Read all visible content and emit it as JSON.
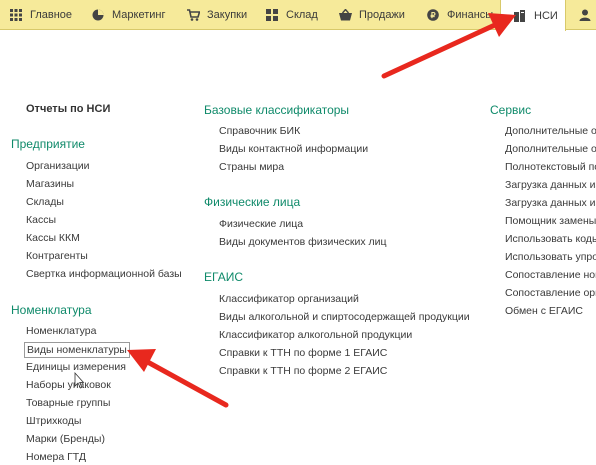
{
  "menu": [
    {
      "label": "Главное",
      "icon": "grid-icon"
    },
    {
      "label": "Маркетинг",
      "icon": "pie-chart-icon"
    },
    {
      "label": "Закупки",
      "icon": "cart-icon"
    },
    {
      "label": "Склад",
      "icon": "warehouse-icon"
    },
    {
      "label": "Продажи",
      "icon": "basket-icon"
    },
    {
      "label": "Финансы",
      "icon": "coin-icon"
    },
    {
      "label": "НСИ",
      "icon": "books-icon"
    },
    {
      "label": "",
      "icon": "user-icon"
    }
  ],
  "col1": {
    "reports": "Отчеты по НСИ",
    "enterprise": {
      "title": "Предприятие",
      "items": [
        "Организации",
        "Магазины",
        "Склады",
        "Кассы",
        "Кассы ККМ",
        "Контрагенты",
        "Свертка информационной базы"
      ]
    },
    "nomenclature": {
      "title": "Номенклатура",
      "items": [
        "Номенклатура",
        "Виды номенклатуры",
        "Единицы измерения",
        "Наборы упаковок",
        "Товарные группы",
        "Штрихкоды",
        "Марки (Бренды)",
        "Номера ГТД"
      ]
    }
  },
  "col2": {
    "base": {
      "title": "Базовые классификаторы",
      "items": [
        "Справочник БИК",
        "Виды контактной информации",
        "Страны мира"
      ]
    },
    "persons": {
      "title": "Физические лица",
      "items": [
        "Физические лица",
        "Виды документов физических лиц"
      ]
    },
    "egais": {
      "title": "ЕГАИС",
      "items": [
        "Классификатор организаций",
        "Виды алкогольной и спиртосодержащей продукции",
        "Классификатор алкогольной продукции",
        "Справки к ТТН по форме 1 ЕГАИС",
        "Справки к ТТН по форме 2 ЕГАИС"
      ]
    }
  },
  "col3": {
    "service": {
      "title": "Сервис",
      "items": [
        "Дополнительные об",
        "Дополнительные от",
        "Полнотекстовый по",
        "Загрузка данных из",
        "Загрузка данных из",
        "Помощник замены с",
        "Использовать коды",
        "Использовать упро",
        "Сопоставление ном",
        "Сопоставление орга",
        "Обмен с ЕГАИС"
      ]
    }
  },
  "colors": {
    "menu_bg": "#f6ea9a",
    "header": "#0f8a6a",
    "arrow": "#e8281e"
  }
}
